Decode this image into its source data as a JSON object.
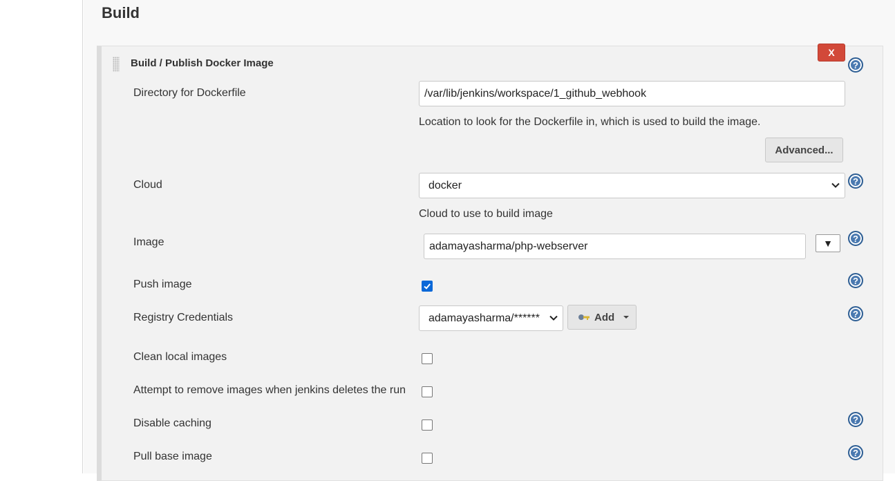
{
  "section": {
    "title": "Build"
  },
  "step": {
    "title": "Build / Publish Docker Image",
    "delete_label": "X",
    "help_glyph": "?"
  },
  "fields": {
    "dockerfile_dir": {
      "label": "Directory for Dockerfile",
      "value": "/var/lib/jenkins/workspace/1_github_webhook",
      "help": "Location to look for the Dockerfile in, which is used to build the image."
    },
    "advanced_label": "Advanced...",
    "cloud": {
      "label": "Cloud",
      "selected": "docker",
      "help": "Cloud to use to build image"
    },
    "image": {
      "label": "Image",
      "value": "adamayasharma/php-webserver",
      "drop_label": "▼"
    },
    "push_image": {
      "label": "Push image",
      "checked": true
    },
    "registry_credentials": {
      "label": "Registry Credentials",
      "selected": "adamayasharma/******",
      "add_label": "Add"
    },
    "clean_local_images": {
      "label": "Clean local images",
      "checked": false
    },
    "remove_on_delete": {
      "label": "Attempt to remove images when jenkins deletes the run",
      "checked": false
    },
    "disable_caching": {
      "label": "Disable caching",
      "checked": false
    },
    "pull_base_image": {
      "label": "Pull base image",
      "checked": false
    }
  },
  "icons": {
    "help": "help-icon",
    "delete": "close-icon",
    "credentials": "key-icon",
    "dropdown": "chevron-down-icon"
  },
  "colors": {
    "delete_button": "#d24939",
    "help_icon": "#4a79b0",
    "checkbox_checked": "#0a68d8"
  }
}
